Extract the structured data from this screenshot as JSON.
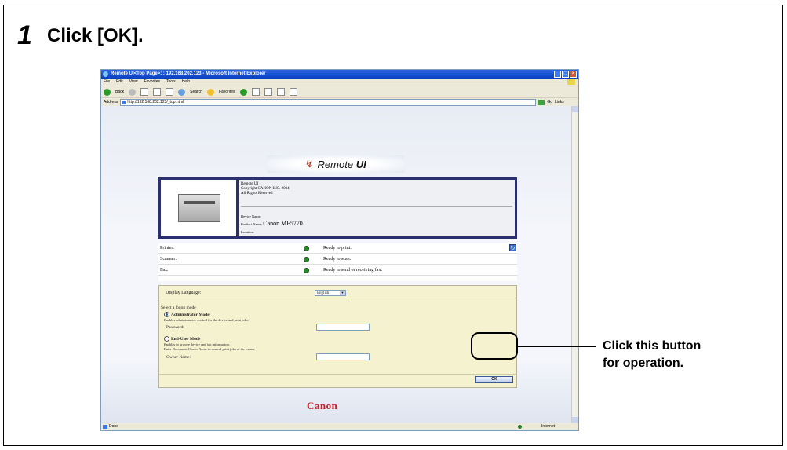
{
  "instruction": {
    "step_number": "1",
    "text": "Click [OK]."
  },
  "browser": {
    "title": "Remote UI<Top Page>: : 192.168.202.123 - Microsoft Internet Explorer",
    "menu": [
      "File",
      "Edit",
      "View",
      "Favorites",
      "Tools",
      "Help"
    ],
    "toolbar": {
      "back": "Back",
      "search": "Search",
      "favorites": "Favorites"
    },
    "address_label": "Address",
    "address_url": "http://192.168.202.123/_top.html",
    "go_label": "Go",
    "links_label": "Links",
    "status_left": "Done",
    "status_zone": "Internet"
  },
  "page": {
    "banner_text_prefix": "Remote",
    "banner_text_bold": "UI",
    "device": {
      "line1": "Remote UI",
      "line2": "Copyright CANON INC. 2004",
      "line3": "All Rights Reserved",
      "device_name_label": "Device Name:",
      "product_name_label": "Product Name:",
      "product_name_value": "Canon MF5770",
      "location_label": "Location:"
    },
    "status": [
      {
        "label": "Printer:",
        "value": "Ready to print."
      },
      {
        "label": "Scanner:",
        "value": "Ready to scan."
      },
      {
        "label": "Fax:",
        "value": "Ready to send or receiving fax."
      }
    ],
    "login": {
      "display_language_label": "Display Language:",
      "language_value": "English",
      "select_mode_label": "Select a logon mode",
      "admin_mode_label": "Administrator Mode",
      "admin_mode_desc": "Enables administrative control for the device and print jobs.",
      "password_label": "Password:",
      "enduser_mode_label": "End-User Mode",
      "enduser_desc1": "Enables to browse device and job information.",
      "enduser_desc2": "Enter Document Owner Name to control print jobs of the owner.",
      "owner_name_label": "Owner Name:",
      "ok_label": "OK"
    },
    "footer_logo": "Canon"
  },
  "callout": {
    "line1": "Click this button",
    "line2": "for operation."
  }
}
